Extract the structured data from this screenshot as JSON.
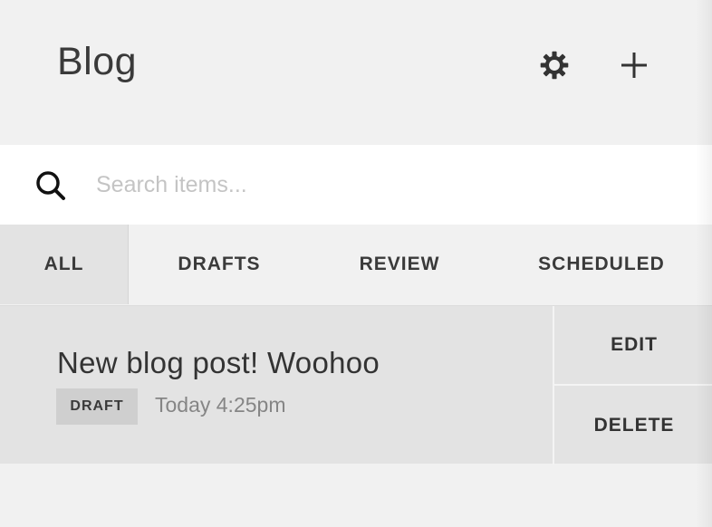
{
  "header": {
    "title": "Blog",
    "settings_icon": "gear-icon",
    "add_icon": "plus-icon"
  },
  "search": {
    "icon": "search-icon",
    "placeholder": "Search items...",
    "value": ""
  },
  "tabs": [
    {
      "label": "ALL",
      "active": true
    },
    {
      "label": "DRAFTS",
      "active": false
    },
    {
      "label": "REVIEW",
      "active": false
    },
    {
      "label": "SCHEDULED",
      "active": false
    }
  ],
  "posts": [
    {
      "title": "New blog post! Woohoo",
      "status": "DRAFT",
      "timestamp": "Today 4:25pm",
      "actions": {
        "edit": "EDIT",
        "delete": "DELETE"
      }
    }
  ],
  "colors": {
    "background": "#f1f1f1",
    "row": "#e3e3e3",
    "badge": "#cfcfcf",
    "text": "#333333",
    "muted": "#858585"
  }
}
